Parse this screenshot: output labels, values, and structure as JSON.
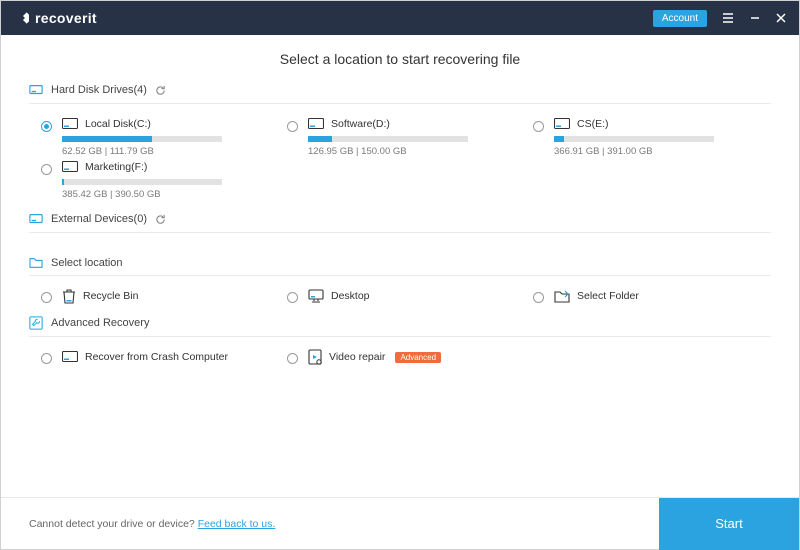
{
  "header": {
    "brand": "recoverit",
    "account_label": "Account"
  },
  "main": {
    "title": "Select a location to start recovering file"
  },
  "sections": {
    "drives": {
      "label": "Hard Disk Drives(4)",
      "items": [
        {
          "name": "Local Disk(C:)",
          "caption": "62.52  GB | 111.79  GB",
          "used_gb": 62.52,
          "total_gb": 111.79,
          "selected": true
        },
        {
          "name": "Software(D:)",
          "caption": "126.95  GB | 150.00  GB",
          "used_gb": 126.95,
          "total_gb": 150.0,
          "selected": false
        },
        {
          "name": "CS(E:)",
          "caption": "366.91  GB | 391.00  GB",
          "used_gb": 366.91,
          "total_gb": 391.0,
          "selected": false
        },
        {
          "name": "Marketing(F:)",
          "caption": "385.42  GB | 390.50  GB",
          "used_gb": 385.42,
          "total_gb": 390.5,
          "selected": false
        }
      ]
    },
    "external": {
      "label": "External Devices(0)",
      "items": []
    },
    "location": {
      "label": "Select location",
      "items": [
        {
          "name": "Recycle Bin",
          "icon": "recycle-bin-icon"
        },
        {
          "name": "Desktop",
          "icon": "desktop-icon"
        },
        {
          "name": "Select Folder",
          "icon": "select-folder-icon"
        }
      ]
    },
    "advanced": {
      "label": "Advanced Recovery",
      "items": [
        {
          "name": "Recover from Crash Computer",
          "icon": "disk-icon"
        },
        {
          "name": "Video repair",
          "icon": "video-repair-icon",
          "badge": "Advanced"
        }
      ]
    }
  },
  "footer": {
    "text": "Cannot detect your drive or device? ",
    "link_text": "Feed back to us.",
    "start_label": "Start"
  },
  "colors": {
    "accent": "#2aa3e0",
    "header_bg": "#273246",
    "badge": "#f26a3d"
  }
}
